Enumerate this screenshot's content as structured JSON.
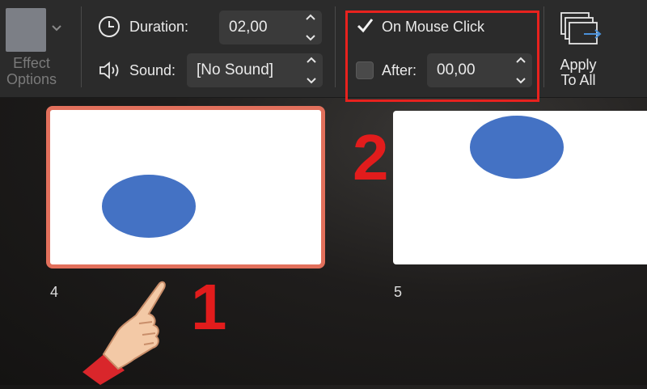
{
  "toolbar": {
    "effect_options": {
      "label_line1": "Effect",
      "label_line2": "Options"
    },
    "duration": {
      "label": "Duration:",
      "value": "02,00"
    },
    "sound": {
      "label": "Sound:",
      "value": "[No Sound]"
    },
    "advance": {
      "on_mouse_click": {
        "label": "On Mouse Click",
        "checked": true
      },
      "after": {
        "label": "After:",
        "checked": false,
        "value": "00,00"
      }
    },
    "apply_to_all": {
      "label_line1": "Apply",
      "label_line2": "To All"
    }
  },
  "slides": [
    {
      "number": "4",
      "selected": true
    },
    {
      "number": "5",
      "selected": false
    }
  ],
  "annotations": {
    "step1": "1",
    "step2": "2"
  },
  "colors": {
    "highlight": "#e8221e",
    "selection_border": "#e2705c",
    "shape_fill": "#4472c4"
  }
}
